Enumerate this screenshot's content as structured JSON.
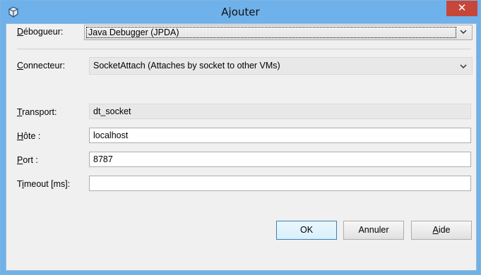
{
  "window": {
    "title": "Ajouter",
    "close_glyph": "✕",
    "icon": "app-cube-icon",
    "title_bar_color": "#6fb1ea",
    "close_button_color": "#c7463a"
  },
  "debugger": {
    "label_mnemonic": "D",
    "label_rest": "ébogueur:",
    "value": "Java Debugger (JPDA)"
  },
  "connector": {
    "label_mnemonic": "C",
    "label_rest": "onnecteur:",
    "value": "SocketAttach (Attaches by socket to other VMs)"
  },
  "transport": {
    "label_mnemonic": "T",
    "label_rest": "ransport:",
    "value": "dt_socket"
  },
  "host": {
    "label_mnemonic": "H",
    "label_rest": "ôte :",
    "value": "localhost"
  },
  "port": {
    "label_mnemonic": "P",
    "label_rest": "ort :",
    "value": "8787"
  },
  "timeout": {
    "label_pre": "T",
    "label_mnemonic": "i",
    "label_rest": "meout [ms]:",
    "value": ""
  },
  "buttons": {
    "ok": "OK",
    "cancel": "Annuler",
    "help_mnemonic": "A",
    "help_rest": "ide"
  }
}
